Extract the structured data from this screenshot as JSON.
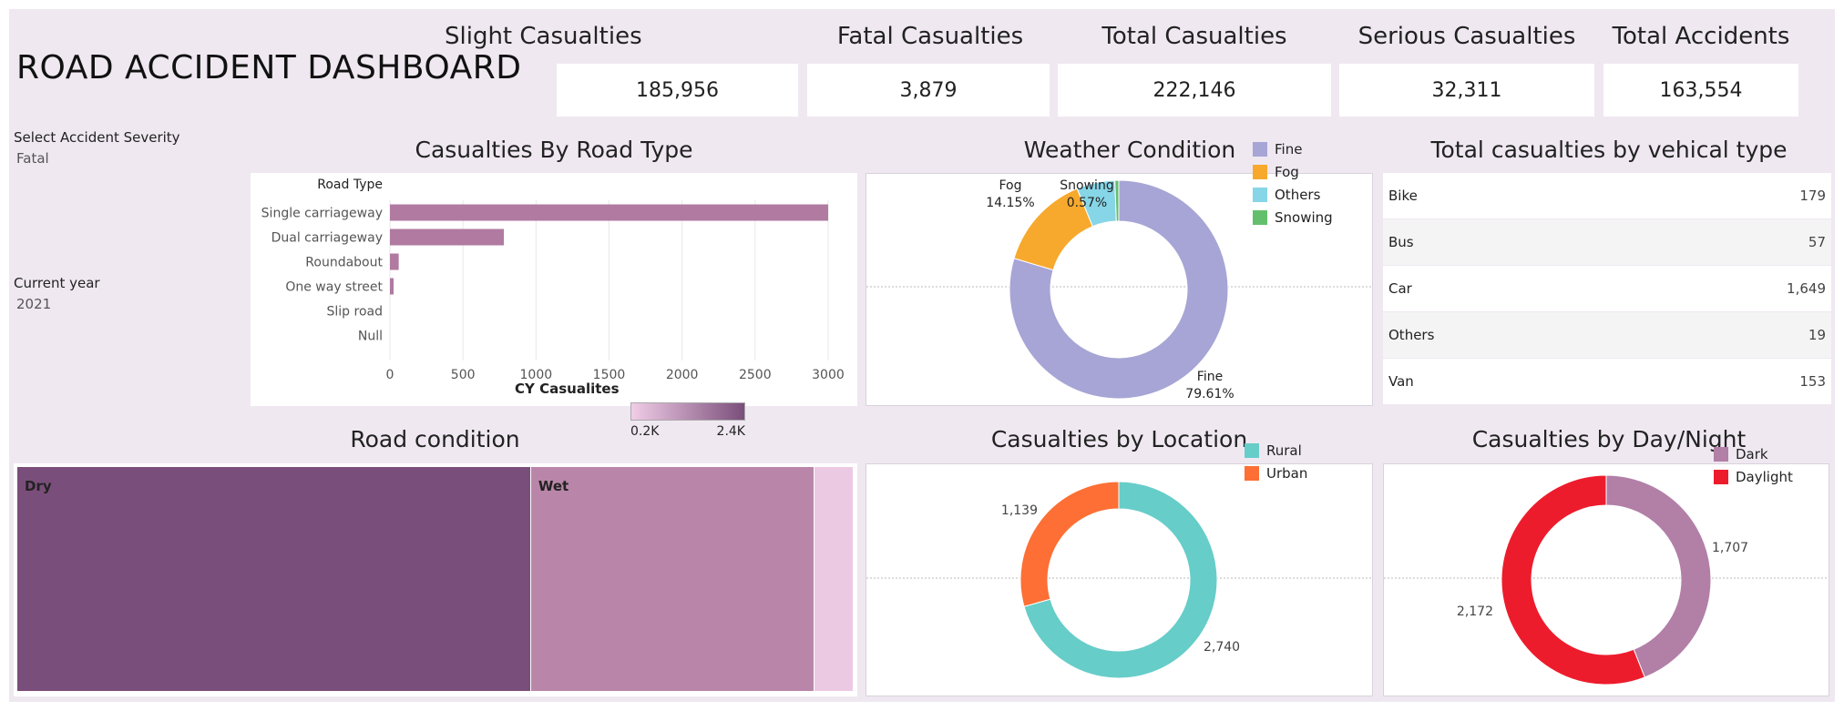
{
  "dashboard": {
    "title": "ROAD ACCIDENT DASHBOARD"
  },
  "kpis": [
    {
      "label": "Slight Casualties",
      "value": "185,956"
    },
    {
      "label": "Fatal Casualties",
      "value": "3,879"
    },
    {
      "label": "Total Casualties",
      "value": "222,146"
    },
    {
      "label": "Serious Casualties",
      "value": "32,311"
    },
    {
      "label": "Total Accidents",
      "value": "163,554"
    }
  ],
  "filters": {
    "severity": {
      "label": "Select Accident Severity",
      "value": "Fatal"
    },
    "year": {
      "label": "Current year",
      "value": "2021"
    }
  },
  "colors": {
    "fine": "#a7a5d5",
    "fog": "#f7a92d",
    "others": "#86d6e7",
    "snowing": "#63bf6c",
    "rural": "#66cdc9",
    "urban": "#fd6f34",
    "dark": "#b27fa7",
    "daylight": "#ed1c2c",
    "bar": "#b07aa1",
    "dry": "#7a4e7a",
    "wet": "#b986a9",
    "other_surface": "#ecc9e3"
  },
  "chart_data": [
    {
      "id": "road_type",
      "type": "bar",
      "orientation": "horizontal",
      "title": "Casualties By Road Type",
      "ylabel": "Road Type",
      "categories": [
        "Single carriageway",
        "Dual carriageway",
        "Roundabout",
        "One way street",
        "Slip road",
        "Null"
      ],
      "values": [
        3000,
        780,
        60,
        25,
        0,
        0
      ],
      "xticks": [
        0,
        500,
        1000,
        1500,
        2000,
        2500,
        3000
      ],
      "xlim": [
        0,
        3100
      ],
      "grid": true,
      "color_legend": {
        "title": "CY Casualites",
        "min_label": "0.2K",
        "max_label": "2.4K"
      }
    },
    {
      "id": "weather",
      "type": "pie",
      "donut": true,
      "title": "Weather Condition",
      "categories": [
        "Fine",
        "Fog",
        "Others",
        "Snowing"
      ],
      "values": [
        79.61,
        14.15,
        5.67,
        0.57
      ],
      "labels": {
        "Fine": "79.61%",
        "Fog": "14.15%",
        "Snowing": "0.57%"
      },
      "legend_position": "top-right"
    },
    {
      "id": "vehicle",
      "type": "table",
      "title": "Total casualties by vehical type",
      "rows": [
        {
          "name": "Bike",
          "value": "179"
        },
        {
          "name": "Bus",
          "value": "57"
        },
        {
          "name": "Car",
          "value": "1,649"
        },
        {
          "name": "Others",
          "value": "19"
        },
        {
          "name": "Van",
          "value": "153"
        }
      ]
    },
    {
      "id": "road_condition",
      "type": "heatmap",
      "subtype": "treemap",
      "title": "Road condition",
      "categories": [
        "Dry",
        "Wet",
        ""
      ],
      "values": [
        2500,
        1380,
        190
      ]
    },
    {
      "id": "location",
      "type": "pie",
      "donut": true,
      "title": "Casualties by Location",
      "categories": [
        "Rural",
        "Urban"
      ],
      "values": [
        2740,
        1139
      ],
      "labels": [
        "2,740",
        "1,139"
      ],
      "legend_position": "top-right"
    },
    {
      "id": "daynight",
      "type": "pie",
      "donut": true,
      "title": "Casualties by Day/Night",
      "categories": [
        "Dark",
        "Daylight"
      ],
      "values": [
        1707,
        2172
      ],
      "labels": [
        "1,707",
        "2,172"
      ],
      "legend_position": "top-right"
    }
  ]
}
